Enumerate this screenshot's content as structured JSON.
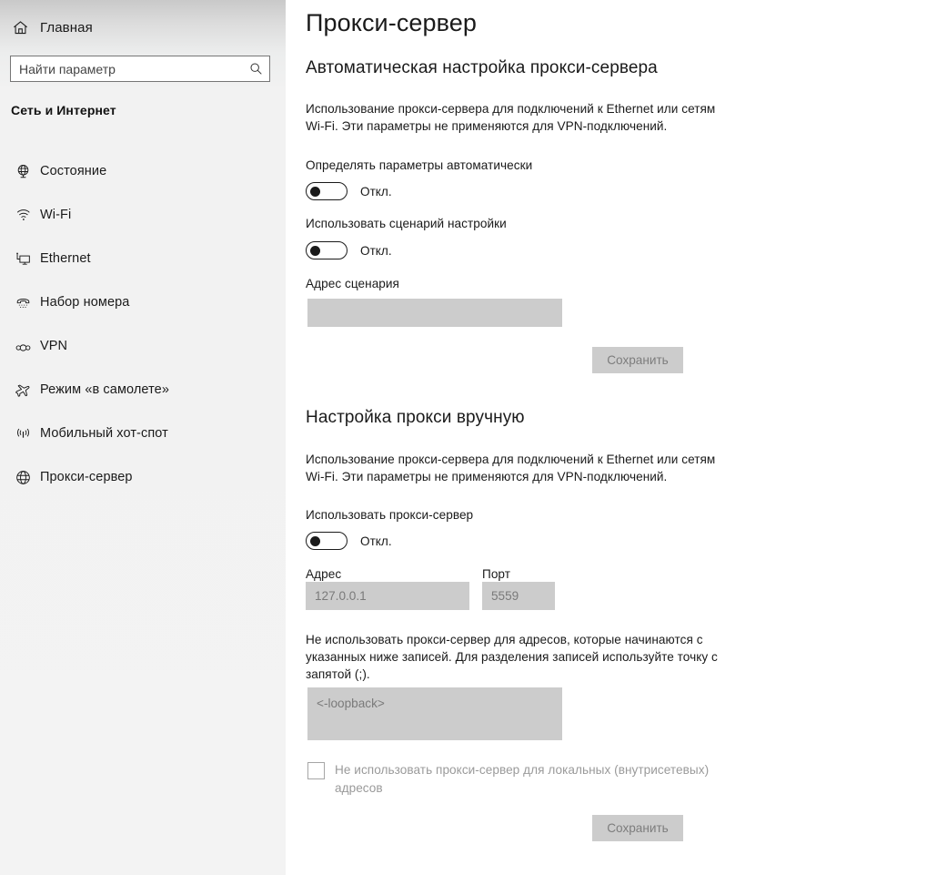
{
  "sidebar": {
    "home": {
      "label": "Главная",
      "icon": "home-icon"
    },
    "search": {
      "placeholder": "Найти параметр",
      "value": "",
      "icon": "search-icon"
    },
    "category": "Сеть и Интернет",
    "items": [
      {
        "label": "Состояние",
        "icon": "globe-stand-icon"
      },
      {
        "label": "Wi-Fi",
        "icon": "wifi-icon"
      },
      {
        "label": "Ethernet",
        "icon": "ethernet-icon"
      },
      {
        "label": "Набор номера",
        "icon": "dialup-phone-icon"
      },
      {
        "label": "VPN",
        "icon": "vpn-icon"
      },
      {
        "label": "Режим «в самолете»",
        "icon": "airplane-icon"
      },
      {
        "label": "Мобильный хот-спот",
        "icon": "hotspot-icon"
      },
      {
        "label": "Прокси-сервер",
        "icon": "globe-icon"
      }
    ]
  },
  "page": {
    "title": "Прокси-сервер",
    "auto_section": {
      "heading": "Автоматическая настройка прокси-сервера",
      "description": "Использование прокси-сервера для подключений к Ethernet или сетям Wi-Fi. Эти параметры не применяются для VPN-подключений.",
      "auto_detect": {
        "label": "Определять параметры автоматически",
        "state": "Откл."
      },
      "use_script": {
        "label": "Использовать сценарий настройки",
        "state": "Откл."
      },
      "script_address": {
        "label": "Адрес сценария",
        "value": "",
        "placeholder": ""
      },
      "save_label": "Сохранить"
    },
    "manual_section": {
      "heading": "Настройка прокси вручную",
      "description": "Использование прокси-сервера для подключений к Ethernet или сетям Wi-Fi. Эти параметры не применяются для VPN-подключений.",
      "use_proxy": {
        "label": "Использовать прокси-сервер",
        "state": "Откл."
      },
      "address": {
        "label": "Адрес",
        "value": "",
        "placeholder": "127.0.0.1"
      },
      "port": {
        "label": "Порт",
        "value": "",
        "placeholder": "5559"
      },
      "exceptions_description": "Не использовать прокси-сервер для адресов, которые начинаются с указанных ниже записей. Для разделения записей используйте точку с запятой (;).",
      "exceptions": {
        "value": "",
        "placeholder": "<-loopback>"
      },
      "bypass_local": {
        "label": "Не использовать прокси-сервер для локальных (внутрисетевых) адресов",
        "checked": false
      },
      "save_label": "Сохранить"
    }
  },
  "colors": {
    "page_background": "#ffffff",
    "sidebar_background": "#f3f3f3",
    "disabled_field": "#cccccc",
    "disabled_text": "#7a7a7a",
    "text": "#1a1a1a",
    "search_border": "#767676"
  }
}
